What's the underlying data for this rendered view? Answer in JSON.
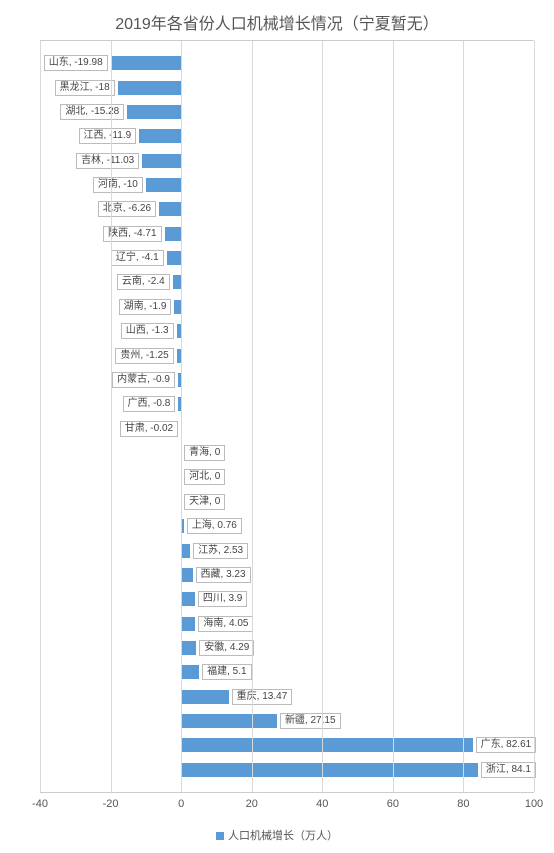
{
  "chart_data": {
    "type": "bar",
    "orientation": "horizontal",
    "title": "2019年各省份人口机械增长情况（宁夏暂无）",
    "xlabel": "",
    "ylabel": "",
    "xlim": [
      -40,
      100
    ],
    "xticks": [
      -40,
      -20,
      0,
      20,
      40,
      60,
      80,
      100
    ],
    "legend": "人口机械增长（万人）",
    "categories": [
      "山东",
      "黑龙江",
      "湖北",
      "江西",
      "吉林",
      "河南",
      "北京",
      "陕西",
      "辽宁",
      "云南",
      "湖南",
      "山西",
      "贵州",
      "内蒙古",
      "广西",
      "甘肃",
      "青海",
      "河北",
      "天津",
      "上海",
      "江苏",
      "西藏",
      "四川",
      "海南",
      "安徽",
      "福建",
      "重庆",
      "新疆",
      "广东",
      "浙江"
    ],
    "values": [
      -19.98,
      -18,
      -15.28,
      -11.9,
      -11.03,
      -10,
      -6.26,
      -4.71,
      -4.1,
      -2.4,
      -1.9,
      -1.3,
      -1.25,
      -0.9,
      -0.8,
      -0.02,
      0,
      0,
      0,
      0.76,
      2.53,
      3.23,
      3.9,
      4.05,
      4.29,
      5.1,
      13.47,
      27.15,
      82.61,
      84.1
    ]
  }
}
